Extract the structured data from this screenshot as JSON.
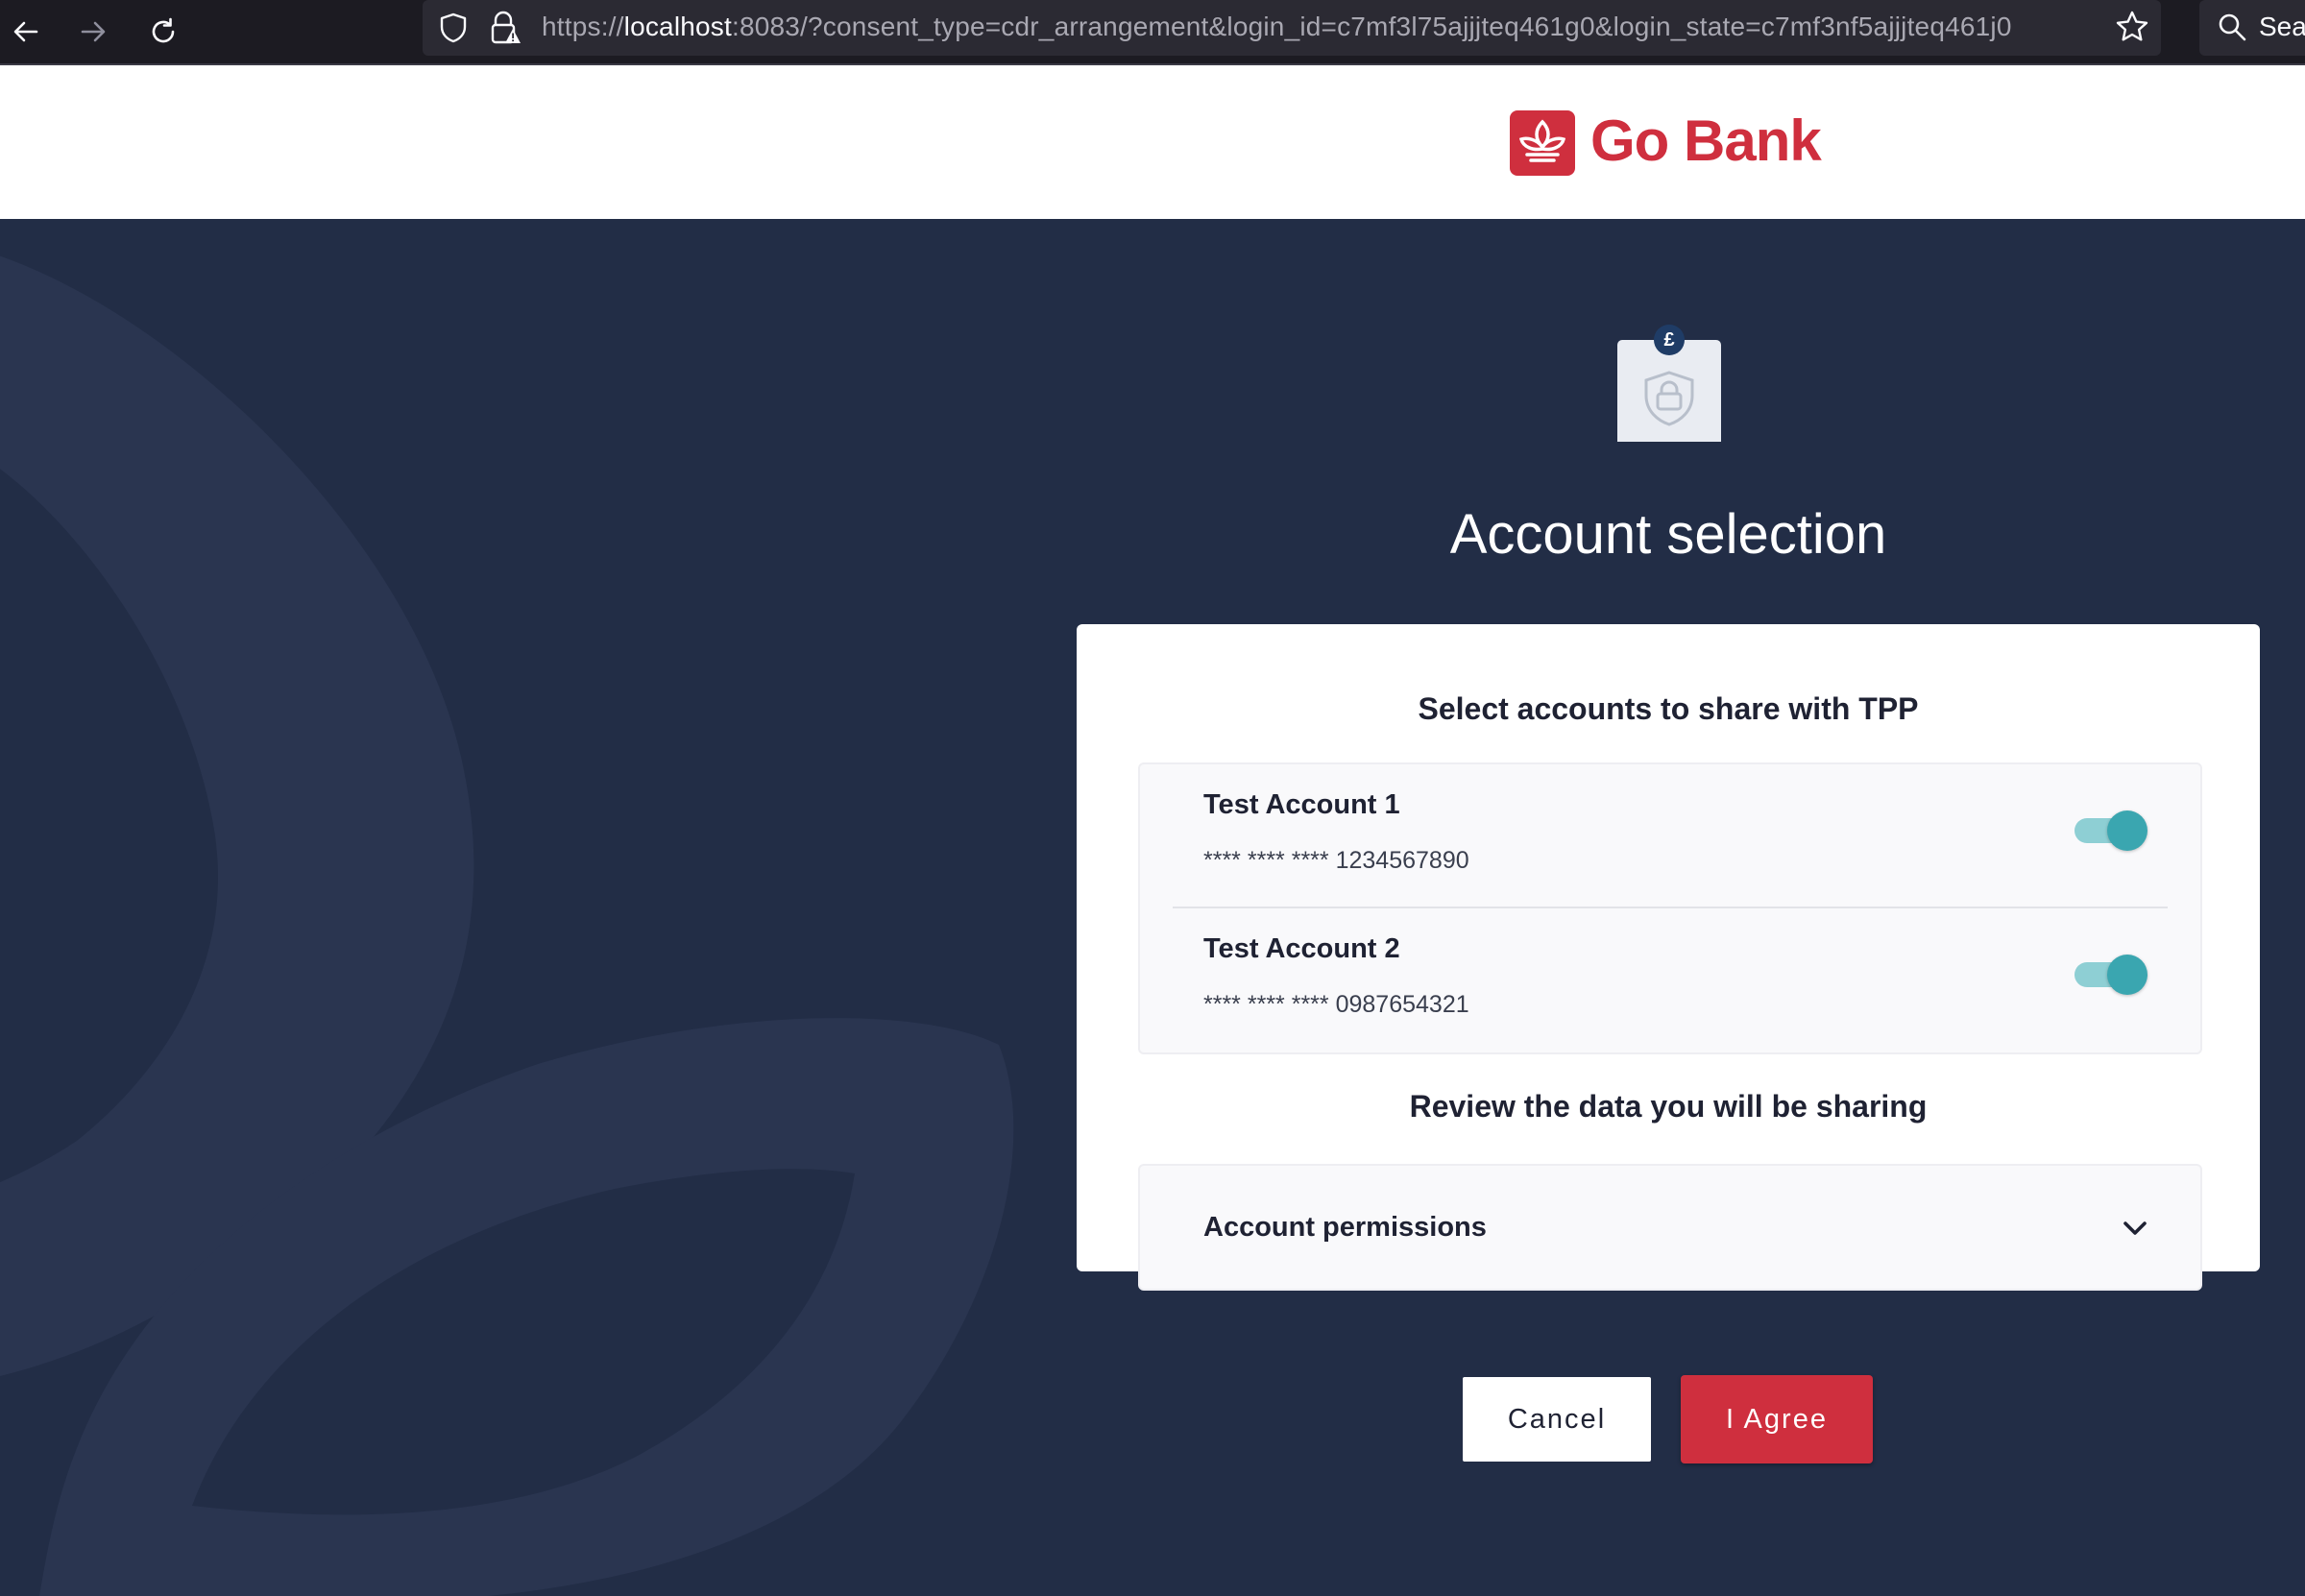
{
  "browser": {
    "url_prefix": "https://",
    "url_host": "localhost",
    "url_rest": ":8083/?consent_type=cdr_arrangement&login_id=c7mf3l75ajjjteq461g0&login_state=c7mf3nf5ajjjteq461j0",
    "search_label": "Sea"
  },
  "header": {
    "brand_name": "Go Bank",
    "brand_color": "#cf2f3e"
  },
  "main": {
    "badge_currency": "£",
    "title": "Account selection"
  },
  "card": {
    "accounts_heading": "Select accounts to share with TPP",
    "accounts": [
      {
        "name": "Test Account 1",
        "number": "**** **** **** 1234567890",
        "selected": true
      },
      {
        "name": "Test Account 2",
        "number": "**** **** **** 0987654321",
        "selected": true
      }
    ],
    "review_heading": "Review the data you will be sharing",
    "permissions_label": "Account permissions",
    "cancel_label": "Cancel",
    "agree_label": "I Agree"
  },
  "colors": {
    "background": "#222d46",
    "accent_red": "#cf2f3e",
    "toggle_on": "#3aa6b0"
  }
}
